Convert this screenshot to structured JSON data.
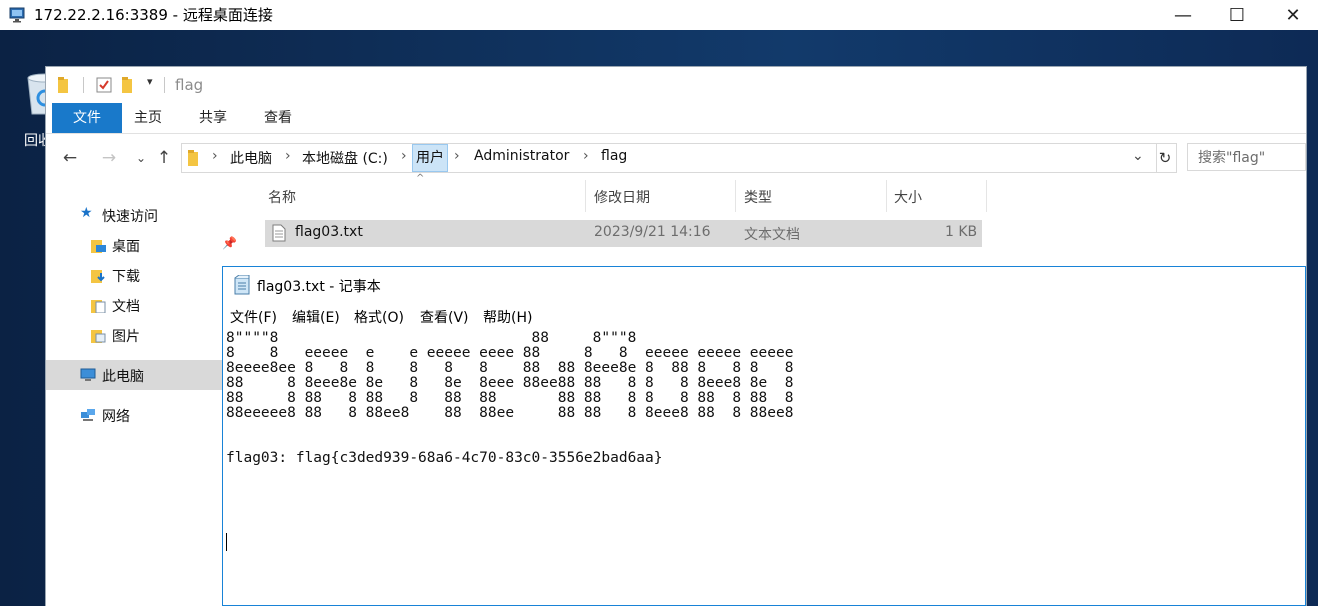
{
  "rdp": {
    "title": "172.22.2.16:3389 - 远程桌面连接",
    "minimize": "—",
    "maximize": "☐",
    "close": "✕"
  },
  "desktop": {
    "recycle_bin_label": "回收站"
  },
  "explorer": {
    "title": "flag",
    "ribbon_tabs": [
      "文件",
      "主页",
      "共享",
      "查看"
    ],
    "breadcrumb": [
      "此电脑",
      "本地磁盘 (C:)",
      "用户",
      "Administrator",
      "flag"
    ],
    "search_placeholder": "搜索\"flag\"",
    "nav": {
      "quick_access": "快速访问",
      "desktop": "桌面",
      "downloads": "下载",
      "documents": "文档",
      "pictures": "图片",
      "this_pc": "此电脑",
      "network": "网络"
    },
    "columns": {
      "name": "名称",
      "modified": "修改日期",
      "type": "类型",
      "size": "大小"
    },
    "files": [
      {
        "name": "flag03.txt",
        "modified": "2023/9/21 14:16",
        "type": "文本文档",
        "size": "1 KB"
      }
    ]
  },
  "notepad": {
    "title": "flag03.txt - 记事本",
    "menu": [
      "文件(F)",
      "编辑(E)",
      "格式(O)",
      "查看(V)",
      "帮助(H)"
    ],
    "content": "8\"\"\"\"8                             88     8\"\"\"8\n8    8   eeeee  e    e eeeee eeee 88     8   8  eeeee eeeee eeeee\n8eeee8ee 8   8  8    8   8   8    88  88 8eee8e 8  88 8   8 8   8\n88     8 8eee8e 8e   8   8e  8eee 88ee88 88   8 8   8 8eee8 8e  8\n88     8 88   8 88   8   88  88       88 88   8 8   8 88  8 88  8\n88eeeee8 88   8 88ee8    88  88ee     88 88   8 8eee8 88  8 88ee8\n\n\nflag03: flag{c3ded939-68a6-4c70-83c0-3556e2bad6aa}"
  }
}
